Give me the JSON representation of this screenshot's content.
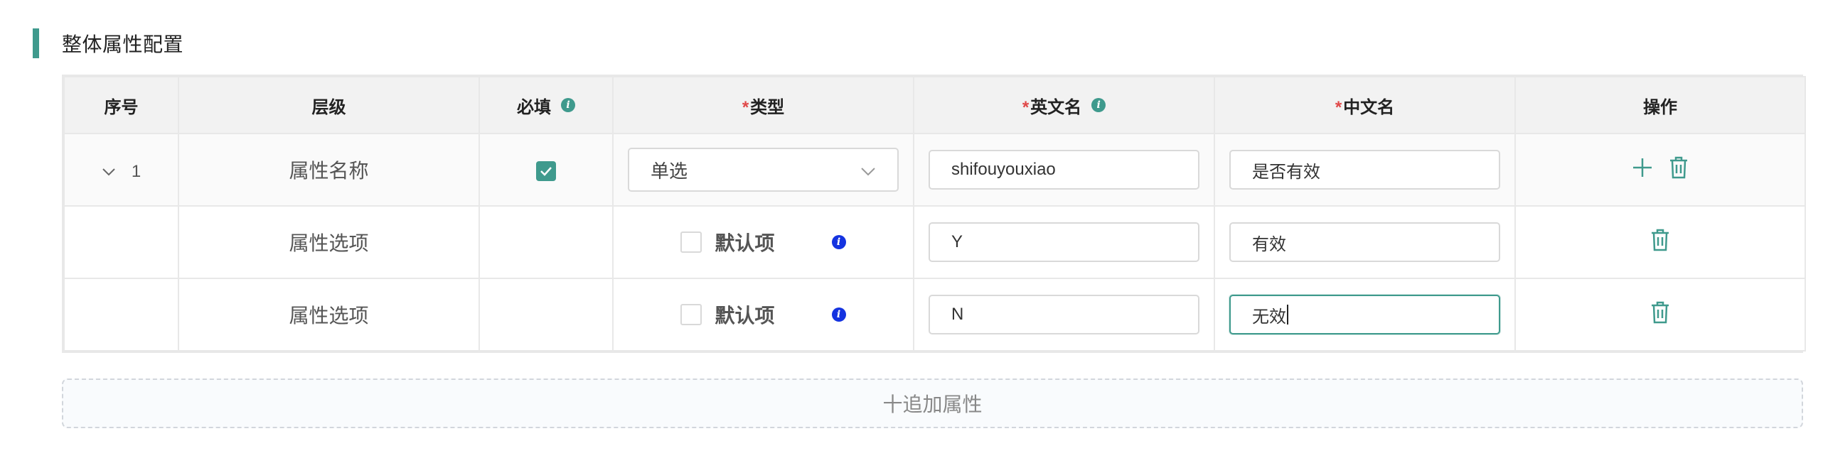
{
  "section": {
    "title": "整体属性配置"
  },
  "table": {
    "headers": {
      "seq": "序号",
      "level": "层级",
      "required": "必填",
      "type_star": "*",
      "type": "类型",
      "en_star": "*",
      "en_name": "英文名",
      "cn_star": "*",
      "cn_name": "中文名",
      "actions": "操作"
    },
    "rows": [
      {
        "seq": "1",
        "level": "属性名称",
        "required_checked": true,
        "type_value": "单选",
        "en_value": "shifouyouxiao",
        "cn_value": "是否有效"
      },
      {
        "level": "属性选项",
        "default_label": "默认项",
        "default_checked": false,
        "en_value": "Y",
        "cn_value": "有效"
      },
      {
        "level": "属性选项",
        "default_label": "默认项",
        "default_checked": false,
        "en_value": "N",
        "cn_value": "无效"
      }
    ]
  },
  "add_button": {
    "label": "十追加属性"
  },
  "colors": {
    "accent": "#3f9a8d",
    "required_star": "#e04848",
    "info_blue": "#1433e0"
  },
  "icons": {
    "expand": "chevron-down-icon",
    "info": "info-icon",
    "add": "plus-icon",
    "delete": "trash-icon",
    "dropdown": "chevron-down-icon",
    "checked": "check-icon"
  }
}
